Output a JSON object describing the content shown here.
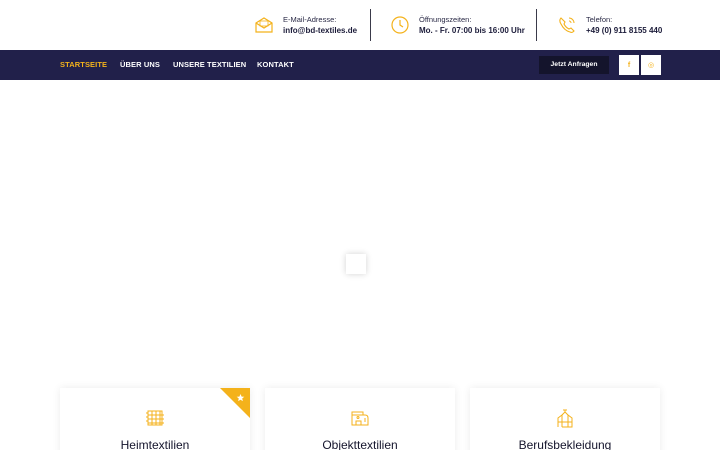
{
  "contact": {
    "email": {
      "label": "E-Mail-Adresse:",
      "value": "info@bd-textiles.de",
      "icon": "envelope-icon"
    },
    "hours": {
      "label": "Öffnungszeiten:",
      "value": "Mo. - Fr. 07:00 bis 16:00 Uhr",
      "icon": "clock-icon"
    },
    "phone": {
      "label": "Telefon:",
      "value": "+49 (0) 911 8155 440",
      "icon": "phone-icon"
    }
  },
  "nav": {
    "items": [
      {
        "label": "STARTSEITE",
        "active": true
      },
      {
        "label": "ÜBER UNS",
        "active": false
      },
      {
        "label": "UNSERE TEXTILIEN",
        "active": false
      },
      {
        "label": "KONTAKT",
        "active": false
      }
    ],
    "cta_label": "Jetzt Anfragen",
    "social": [
      {
        "name": "facebook-icon",
        "glyph": "f"
      },
      {
        "name": "instagram-icon",
        "glyph": "◎"
      }
    ]
  },
  "cards": [
    {
      "title": "Heimtextilien",
      "icon": "fabric-icon",
      "featured": true
    },
    {
      "title": "Objekttextilien",
      "icon": "sewing-machine-icon",
      "featured": false
    },
    {
      "title": "Berufsbekleidung",
      "icon": "workwear-icon",
      "featured": false
    }
  ],
  "colors": {
    "accent": "#f4b21b",
    "nav_bg": "#21204a",
    "cta_bg": "#14142c",
    "text_dark": "#1c1c3a"
  }
}
